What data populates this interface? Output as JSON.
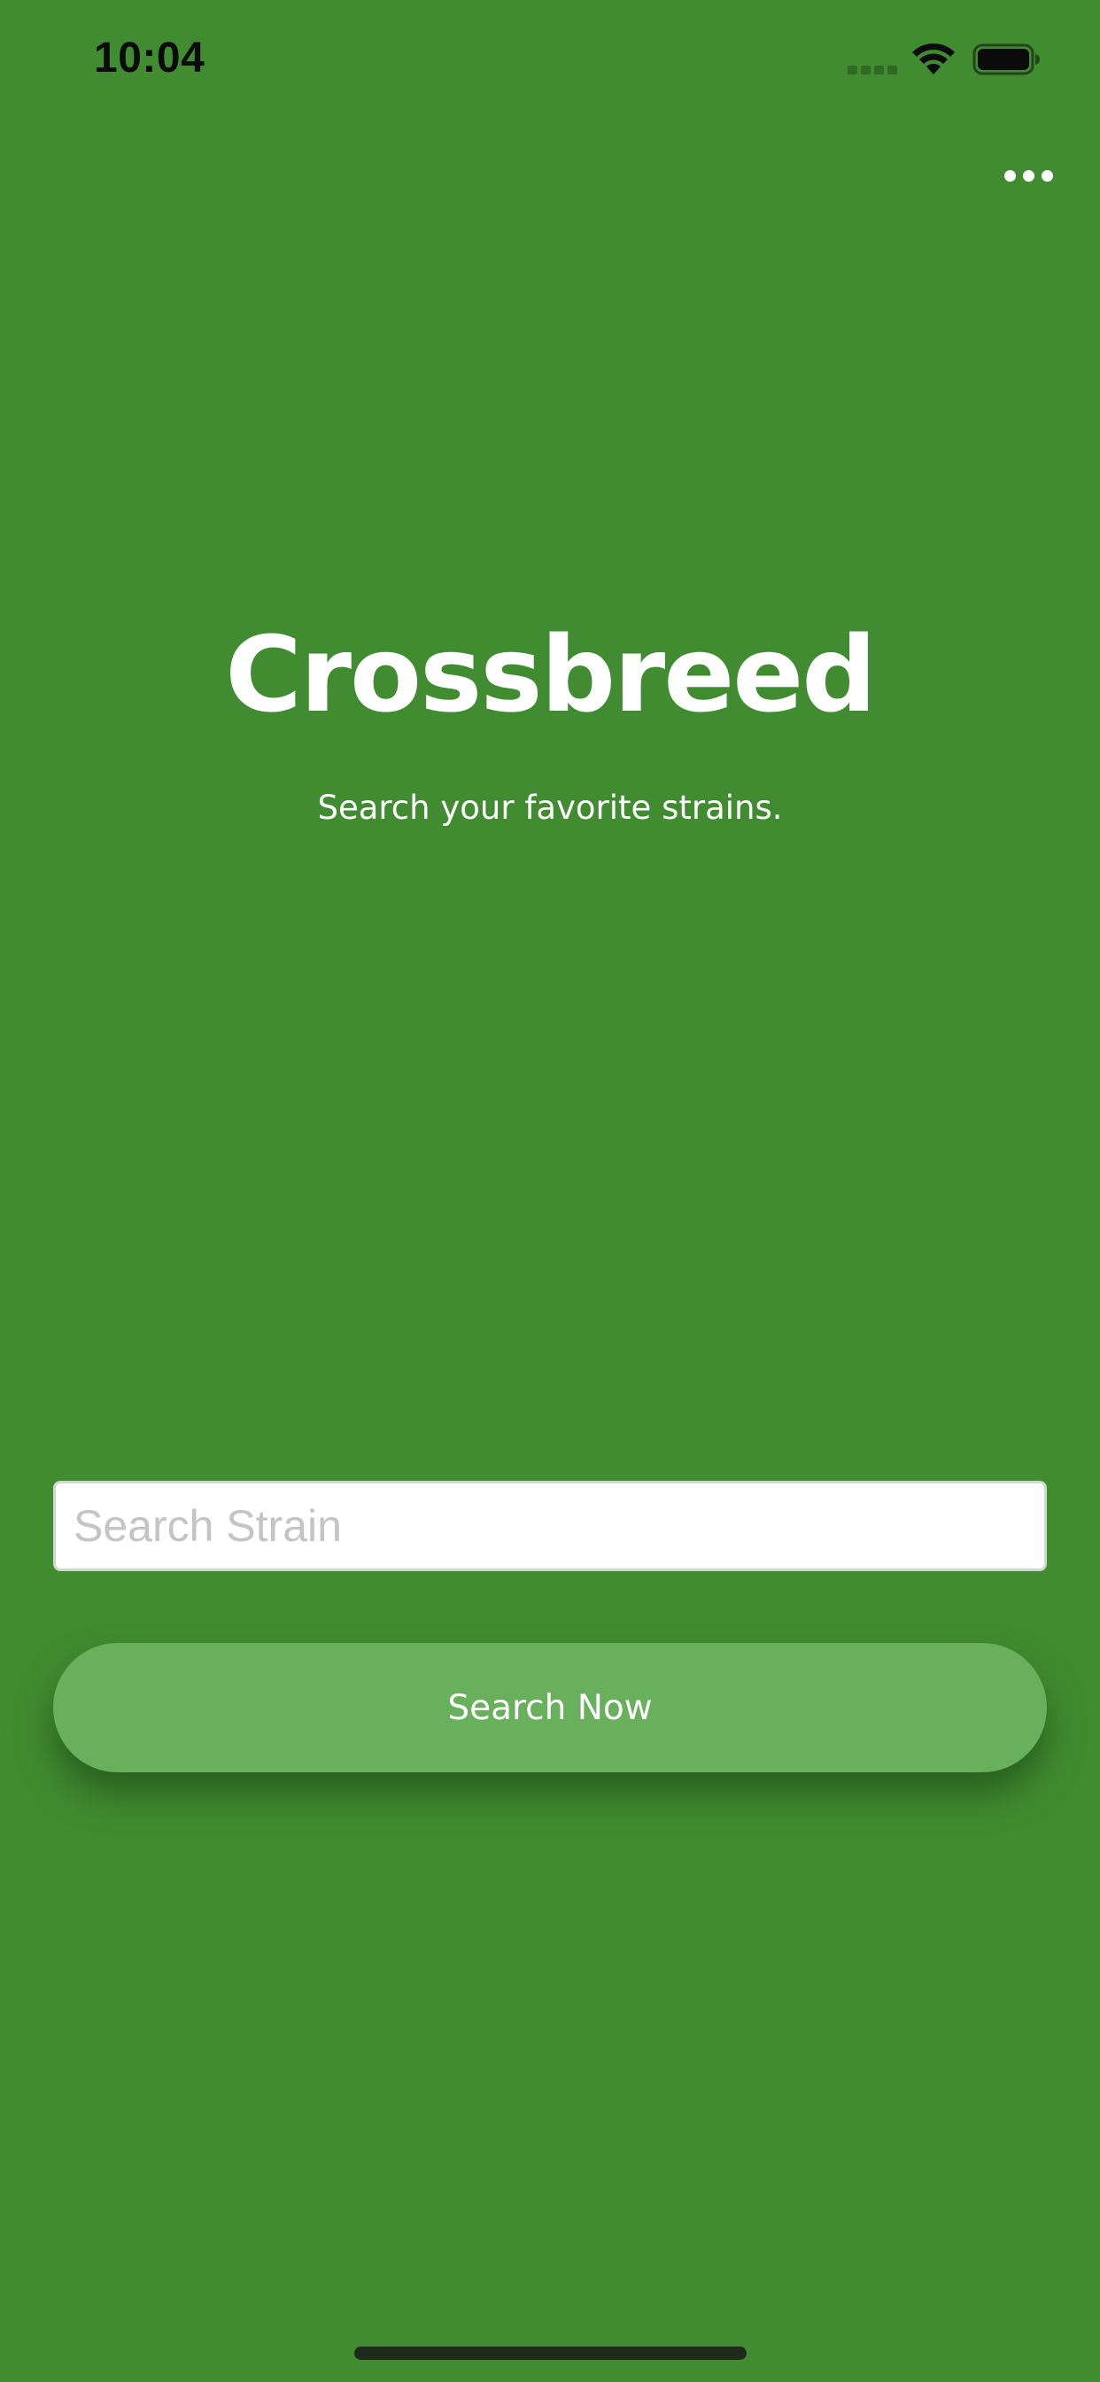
{
  "status_bar": {
    "time": "10:04",
    "icons": [
      "cellular-signal-icon",
      "wifi-icon",
      "battery-icon"
    ]
  },
  "header": {
    "more_icon": "more-horizontal-icon"
  },
  "hero": {
    "title": "Crossbreed",
    "subtitle": "Search your favorite strains."
  },
  "search": {
    "placeholder": "Search Strain",
    "value": "",
    "button_label": "Search Now"
  },
  "colors": {
    "background": "#418c31",
    "button": "#68b05b",
    "text": "#ffffff"
  }
}
